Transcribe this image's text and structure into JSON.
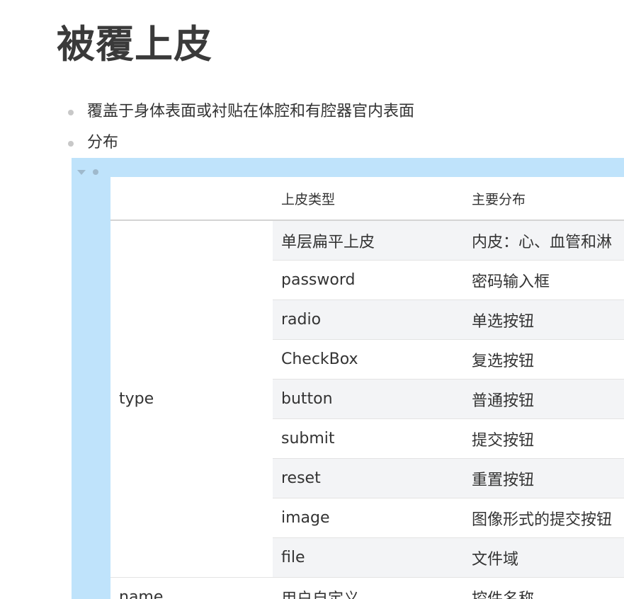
{
  "page": {
    "title": "被覆上皮"
  },
  "bullets": [
    {
      "text": "覆盖于身体表面或衬贴在体腔和有腔器官内表面"
    },
    {
      "text": "分布"
    }
  ],
  "table": {
    "headers": [
      "",
      "上皮类型",
      "主要分布"
    ],
    "groups": [
      {
        "key": "type",
        "rows": [
          [
            "单层扁平上皮",
            "内皮：心、血管和淋"
          ],
          [
            "password",
            "密码输入框"
          ],
          [
            "radio",
            "单选按钮"
          ],
          [
            "CheckBox",
            "复选按钮"
          ],
          [
            "button",
            "普通按钮"
          ],
          [
            "submit",
            "提交按钮"
          ],
          [
            "reset",
            "重置按钮"
          ],
          [
            "image",
            "图像形式的提交按钮"
          ],
          [
            "file",
            "文件域"
          ]
        ]
      },
      {
        "key": "name",
        "rows": [
          [
            "用户自定义",
            "控件名称"
          ]
        ]
      }
    ]
  },
  "icons": {
    "collapse": "triangle-down-icon",
    "block_handle": "dot-handle-icon"
  },
  "colors": {
    "block_highlight": "#bfe3fb",
    "row_shade": "#f3f4f6",
    "bullet_dot": "#c8c8c8"
  }
}
